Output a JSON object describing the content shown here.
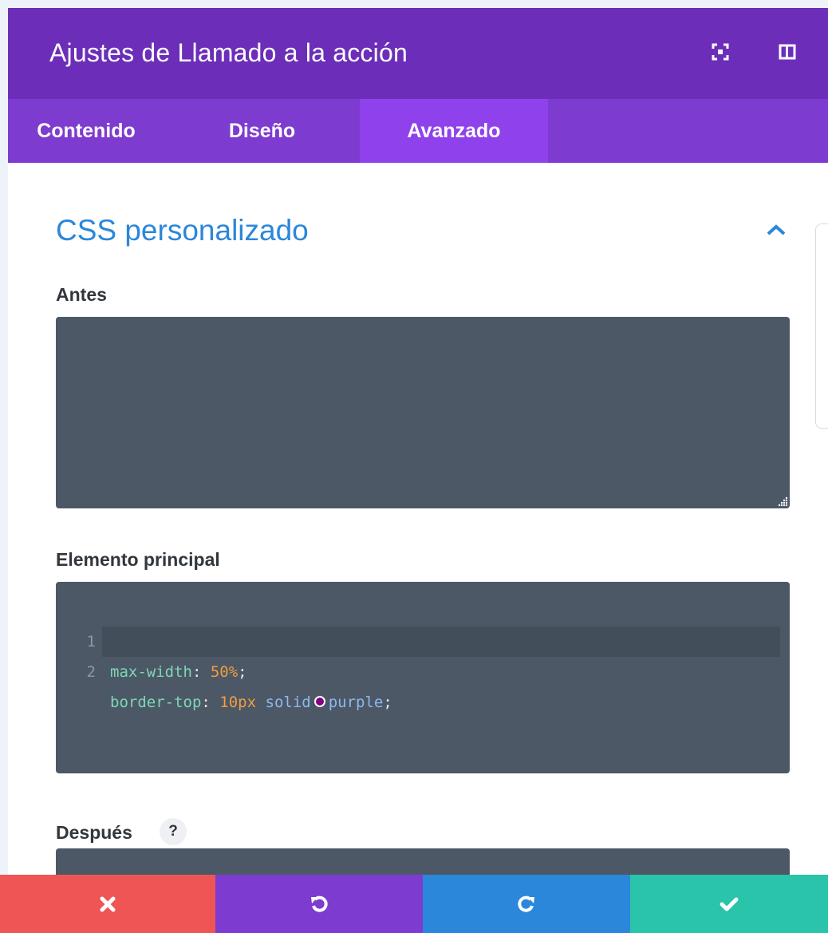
{
  "header": {
    "title": "Ajustes de Llamado a la acción",
    "icons": [
      "fullscreen-icon",
      "sidebar-layout-icon"
    ]
  },
  "tabs": [
    {
      "label": "Contenido",
      "active": false
    },
    {
      "label": "Diseño",
      "active": false
    },
    {
      "label": "Avanzado",
      "active": true
    }
  ],
  "section": {
    "title": "CSS personalizado",
    "toggle_icon": "chevron-up-icon"
  },
  "fields": {
    "before": {
      "label": "Antes",
      "value": ""
    },
    "main": {
      "label": "Elemento principal",
      "lines": [
        {
          "num": "1",
          "prop": "max-width",
          "colon": ": ",
          "value": "50%",
          "semi": ";"
        },
        {
          "num": "2",
          "prop": "border-top",
          "colon": ": ",
          "num_value": "10px",
          "kw1": "solid",
          "kw2": "purple",
          "semi": ";"
        }
      ],
      "swatch_color": "#800080"
    },
    "after": {
      "label": "Después",
      "help": "?"
    }
  },
  "footer": {
    "buttons": [
      {
        "name": "discard",
        "icon": "close-icon",
        "color": "#ef5555"
      },
      {
        "name": "undo",
        "icon": "undo-icon",
        "color": "#7e3bd0"
      },
      {
        "name": "redo",
        "icon": "redo-icon",
        "color": "#2b87da"
      },
      {
        "name": "save",
        "icon": "checkmark-icon",
        "color": "#29c4a9"
      }
    ]
  },
  "colors": {
    "header_bg": "#6c2eb9",
    "tabs_bg": "#7e3bd0",
    "tab_active_bg": "#8f42ec",
    "section_title": "#2b87da",
    "code_bg": "#4c5866"
  }
}
